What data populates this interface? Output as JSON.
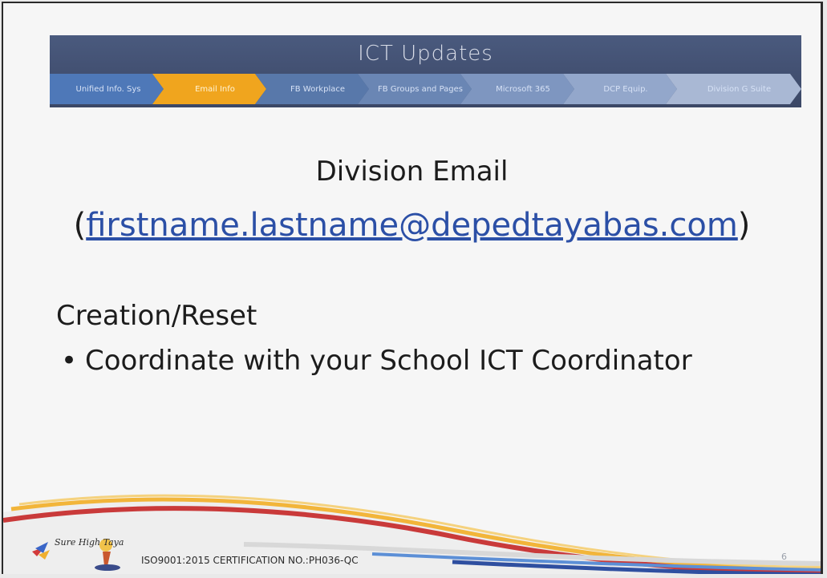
{
  "banner": {
    "title": "ICT Updates",
    "steps": [
      {
        "label": "Unified Info. Sys",
        "color": "#4e78b8"
      },
      {
        "label": "Email Info",
        "color": "#f0a51e"
      },
      {
        "label": "FB Workplace",
        "color": "#5878aa"
      },
      {
        "label": "FB Groups and Pages",
        "color": "#6a86b4"
      },
      {
        "label": "Microsoft 365",
        "color": "#7e96c0"
      },
      {
        "label": "DCP Equip.",
        "color": "#93a7cb"
      },
      {
        "label": "Division G Suite",
        "color": "#a9b8d4"
      }
    ]
  },
  "content": {
    "heading": "Division Email",
    "email_open": "(",
    "email_link": "firstname.lastname@depedtayabas.com",
    "email_close": ")",
    "subheading": "Creation/Reset",
    "bullet_marker": "•",
    "bullet_text": "Coordinate with your School ICT Coordinator"
  },
  "footer": {
    "logo_text": "Sure High Tayabas",
    "certification": "ISO9001:2015 CERTIFICATION NO.:PH036-QC",
    "page_number": "6"
  },
  "colors": {
    "accent": "#f0a51e",
    "link": "#2b4fa6",
    "banner": "#4a5a7e"
  }
}
